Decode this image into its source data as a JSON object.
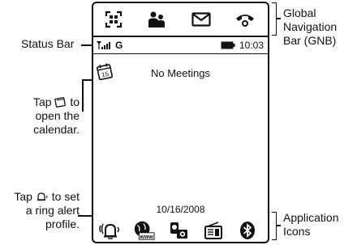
{
  "callouts": {
    "status_bar": "Status Bar",
    "gnb": [
      "Global",
      "Navigation",
      "Bar (GNB)"
    ],
    "tap_calendar": [
      "Tap",
      "to",
      "open the",
      "calendar."
    ],
    "tap_ring": [
      "Tap",
      "to set",
      "a ring alert",
      "profile."
    ],
    "application_icons": [
      "Application",
      "Icons"
    ]
  },
  "screen": {
    "network_indicator": "G",
    "time": "10:03",
    "calendar_day": "15",
    "meetings_text": "No Meetings",
    "date": "10/16/2008",
    "browser_icon_label": "www"
  },
  "icons": {
    "gnb": [
      "grid-menu-icon",
      "contacts-icon",
      "envelope-icon",
      "phone-handset-icon"
    ],
    "apps": [
      "ring-alert-icon",
      "web-browser-icon",
      "camera-icon",
      "radio-icon",
      "bluetooth-icon"
    ]
  }
}
